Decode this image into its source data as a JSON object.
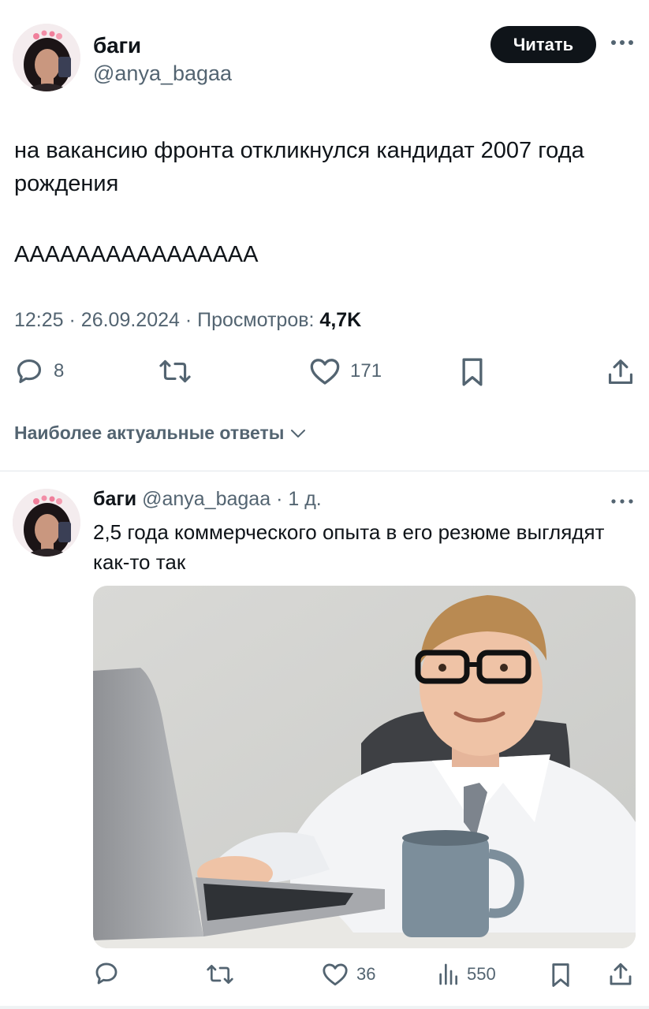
{
  "main_tweet": {
    "author_name": "баги",
    "author_handle": "@anya_bagaa",
    "follow_label": "Читать",
    "text_line": "на вакансию фронта откликнулся кандидат 2007 года рождения",
    "text_scream": "АААААААААААААААА",
    "time": "12:25",
    "date": "26.09.2024",
    "views_label": "Просмотров:",
    "views_value": "4,7K",
    "actions": {
      "replies": "8",
      "likes": "171"
    }
  },
  "replies_sort": {
    "label": "Наиболее актуальные ответы"
  },
  "reply": {
    "author_name": "баги",
    "author_handle": "@anya_bagaa",
    "age": "1 д.",
    "text": "2,5 года коммерческого опыта в его резюме выглядят как-то так",
    "actions": {
      "likes": "36",
      "views": "550"
    }
  },
  "colors": {
    "text_primary": "#0f1419",
    "text_secondary": "#536471",
    "button_bg": "#0f1419",
    "divider": "#e1e6ea"
  },
  "icons": {
    "reply": "speech-bubble-icon",
    "repost": "repost-arrows-icon",
    "like": "heart-icon",
    "bookmark": "bookmark-icon",
    "share": "share-upload-icon",
    "views": "bar-chart-icon",
    "more": "three-dots-icon",
    "sort": "chevron-down-icon"
  }
}
